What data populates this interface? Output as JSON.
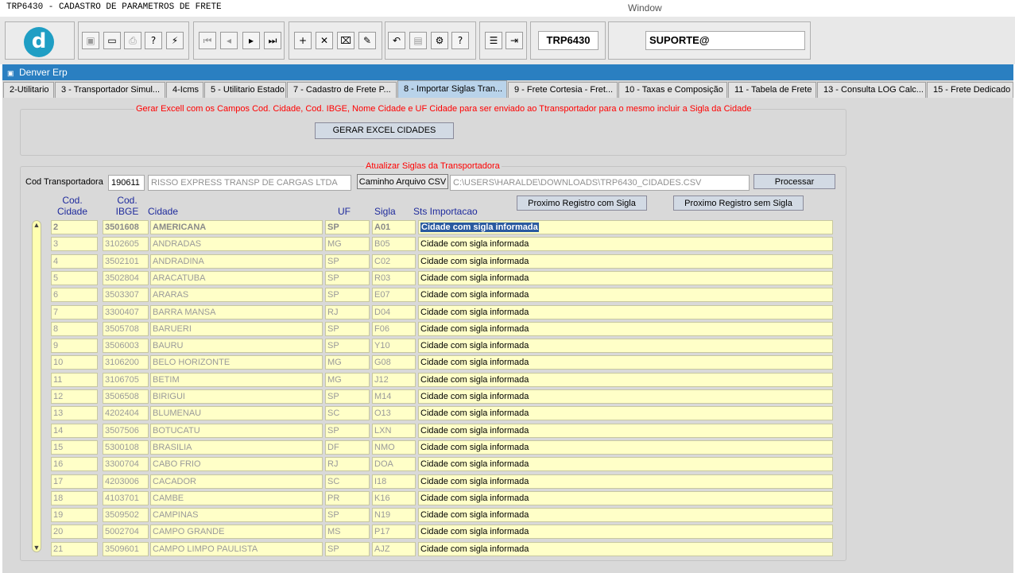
{
  "window": {
    "title": "TRP6430 - CADASTRO DE PARAMETROS DE FRETE",
    "menu": "Window"
  },
  "toolbar": {
    "logo_letter": "d",
    "form_code": "TRP6430",
    "user": "SUPORTE@",
    "buttons": [
      {
        "name": "save-icon",
        "glyph": "▣",
        "enabled": false
      },
      {
        "name": "window-icon",
        "glyph": "▭",
        "enabled": true
      },
      {
        "name": "print-icon",
        "glyph": "⎙",
        "enabled": false
      },
      {
        "name": "help-query-icon",
        "glyph": "?",
        "enabled": true
      },
      {
        "name": "execute-query-icon",
        "glyph": "⚡",
        "enabled": true
      },
      {
        "name": "first-record-icon",
        "glyph": "⏮",
        "enabled": false
      },
      {
        "name": "previous-record-icon",
        "glyph": "◂",
        "enabled": false
      },
      {
        "name": "next-record-icon",
        "glyph": "▸",
        "enabled": true
      },
      {
        "name": "last-record-icon",
        "glyph": "⏭",
        "enabled": true
      },
      {
        "name": "insert-record-icon",
        "glyph": "+",
        "enabled": true
      },
      {
        "name": "delete-record-icon",
        "glyph": "✕",
        "enabled": true
      },
      {
        "name": "clear-record-icon",
        "glyph": "⌧",
        "enabled": true
      },
      {
        "name": "edit-icon",
        "glyph": "✎",
        "enabled": true
      },
      {
        "name": "undo-icon",
        "glyph": "↶",
        "enabled": true
      },
      {
        "name": "clipboard-icon",
        "glyph": "▤",
        "enabled": false
      },
      {
        "name": "settings-icon",
        "glyph": "⚙",
        "enabled": true
      },
      {
        "name": "help-icon",
        "glyph": "?",
        "enabled": true
      },
      {
        "name": "menu-icon",
        "glyph": "☰",
        "enabled": true
      },
      {
        "name": "exit-icon",
        "glyph": "⇥",
        "enabled": true
      }
    ]
  },
  "erp_header": "Denver Erp",
  "tabs": [
    "2-Utilitario",
    "3 - Transportador Simul...",
    "4-Icms",
    "5 - Utilitario Estado",
    "7 - Cadastro de Frete P...",
    "8 - Importar Siglas Tran...",
    "9 - Frete Cortesia - Fret...",
    "10 - Taxas e Composição",
    "11 - Tabela de Frete",
    "13 - Consulta LOG Calc...",
    "15 - Frete Dedicado"
  ],
  "export_section": {
    "title": "Gerar Excell com os Campos Cod. Cidade, Cod. IBGE, Nome Cidade e UF Cidade para ser enviado ao Ttransportador para o mesmo incluir a Sigla da Cidade",
    "button": "GERAR EXCEL CIDADES"
  },
  "update_section": {
    "title": "Atualizar Siglas da Transportadora",
    "cod_label": "Cod Transportadora",
    "cod_value": "190611",
    "carrier_name": "RISSO EXPRESS TRANSP DE CARGAS LTDA",
    "csv_button": "Caminho Arquivo CSV",
    "csv_path": "C:\\USERS\\HARALDE\\DOWNLOADS\\TRP6430_CIDADES.CSV",
    "process_button": "Processar",
    "next_with_button": "Proximo Registro com Sigla",
    "next_without_button": "Proximo Registro sem Sigla"
  },
  "grid": {
    "headers": {
      "cod_cidade": "Cod.\nCidade",
      "cod_ibge": "Cod.\nIBGE",
      "cidade": "Cidade",
      "uf": "UF",
      "sigla": "Sigla",
      "status": "Sts Importacao"
    },
    "rows": [
      {
        "cod": "2",
        "ibge": "3501608",
        "cidade": "AMERICANA",
        "uf": "SP",
        "sigla": "A01",
        "status": "Cidade com sigla informada"
      },
      {
        "cod": "3",
        "ibge": "3102605",
        "cidade": "ANDRADAS",
        "uf": "MG",
        "sigla": "B05",
        "status": "Cidade com sigla informada"
      },
      {
        "cod": "4",
        "ibge": "3502101",
        "cidade": "ANDRADINA",
        "uf": "SP",
        "sigla": "C02",
        "status": "Cidade com sigla informada"
      },
      {
        "cod": "5",
        "ibge": "3502804",
        "cidade": "ARACATUBA",
        "uf": "SP",
        "sigla": "R03",
        "status": "Cidade com sigla informada"
      },
      {
        "cod": "6",
        "ibge": "3503307",
        "cidade": "ARARAS",
        "uf": "SP",
        "sigla": "E07",
        "status": "Cidade com sigla informada"
      },
      {
        "cod": "7",
        "ibge": "3300407",
        "cidade": "BARRA MANSA",
        "uf": "RJ",
        "sigla": "D04",
        "status": "Cidade com sigla informada"
      },
      {
        "cod": "8",
        "ibge": "3505708",
        "cidade": "BARUERI",
        "uf": "SP",
        "sigla": "F06",
        "status": "Cidade com sigla informada"
      },
      {
        "cod": "9",
        "ibge": "3506003",
        "cidade": "BAURU",
        "uf": "SP",
        "sigla": "Y10",
        "status": "Cidade com sigla informada"
      },
      {
        "cod": "10",
        "ibge": "3106200",
        "cidade": "BELO HORIZONTE",
        "uf": "MG",
        "sigla": "G08",
        "status": "Cidade com sigla informada"
      },
      {
        "cod": "11",
        "ibge": "3106705",
        "cidade": "BETIM",
        "uf": "MG",
        "sigla": "J12",
        "status": "Cidade com sigla informada"
      },
      {
        "cod": "12",
        "ibge": "3506508",
        "cidade": "BIRIGUI",
        "uf": "SP",
        "sigla": "M14",
        "status": "Cidade com sigla informada"
      },
      {
        "cod": "13",
        "ibge": "4202404",
        "cidade": "BLUMENAU",
        "uf": "SC",
        "sigla": "O13",
        "status": "Cidade com sigla informada"
      },
      {
        "cod": "14",
        "ibge": "3507506",
        "cidade": "BOTUCATU",
        "uf": "SP",
        "sigla": "LXN",
        "status": "Cidade com sigla informada"
      },
      {
        "cod": "15",
        "ibge": "5300108",
        "cidade": "BRASILIA",
        "uf": "DF",
        "sigla": "NMO",
        "status": "Cidade com sigla informada"
      },
      {
        "cod": "16",
        "ibge": "3300704",
        "cidade": "CABO FRIO",
        "uf": "RJ",
        "sigla": "DOA",
        "status": "Cidade com sigla informada"
      },
      {
        "cod": "17",
        "ibge": "4203006",
        "cidade": "CACADOR",
        "uf": "SC",
        "sigla": "I18",
        "status": "Cidade com sigla informada"
      },
      {
        "cod": "18",
        "ibge": "4103701",
        "cidade": "CAMBE",
        "uf": "PR",
        "sigla": "K16",
        "status": "Cidade com sigla informada"
      },
      {
        "cod": "19",
        "ibge": "3509502",
        "cidade": "CAMPINAS",
        "uf": "SP",
        "sigla": "N19",
        "status": "Cidade com sigla informada"
      },
      {
        "cod": "20",
        "ibge": "5002704",
        "cidade": "CAMPO GRANDE",
        "uf": "MS",
        "sigla": "P17",
        "status": "Cidade com sigla informada"
      },
      {
        "cod": "21",
        "ibge": "3509601",
        "cidade": "CAMPO LIMPO PAULISTA",
        "uf": "SP",
        "sigla": "AJZ",
        "status": "Cidade com sigla informada"
      }
    ]
  },
  "colors": {
    "header_blue": "#2a7fc1",
    "section_title_red": "#ff0000",
    "column_header_blue": "#1e2a9c",
    "grid_cell_bg": "#ffffc8",
    "active_tab": "#b9d3ea"
  }
}
